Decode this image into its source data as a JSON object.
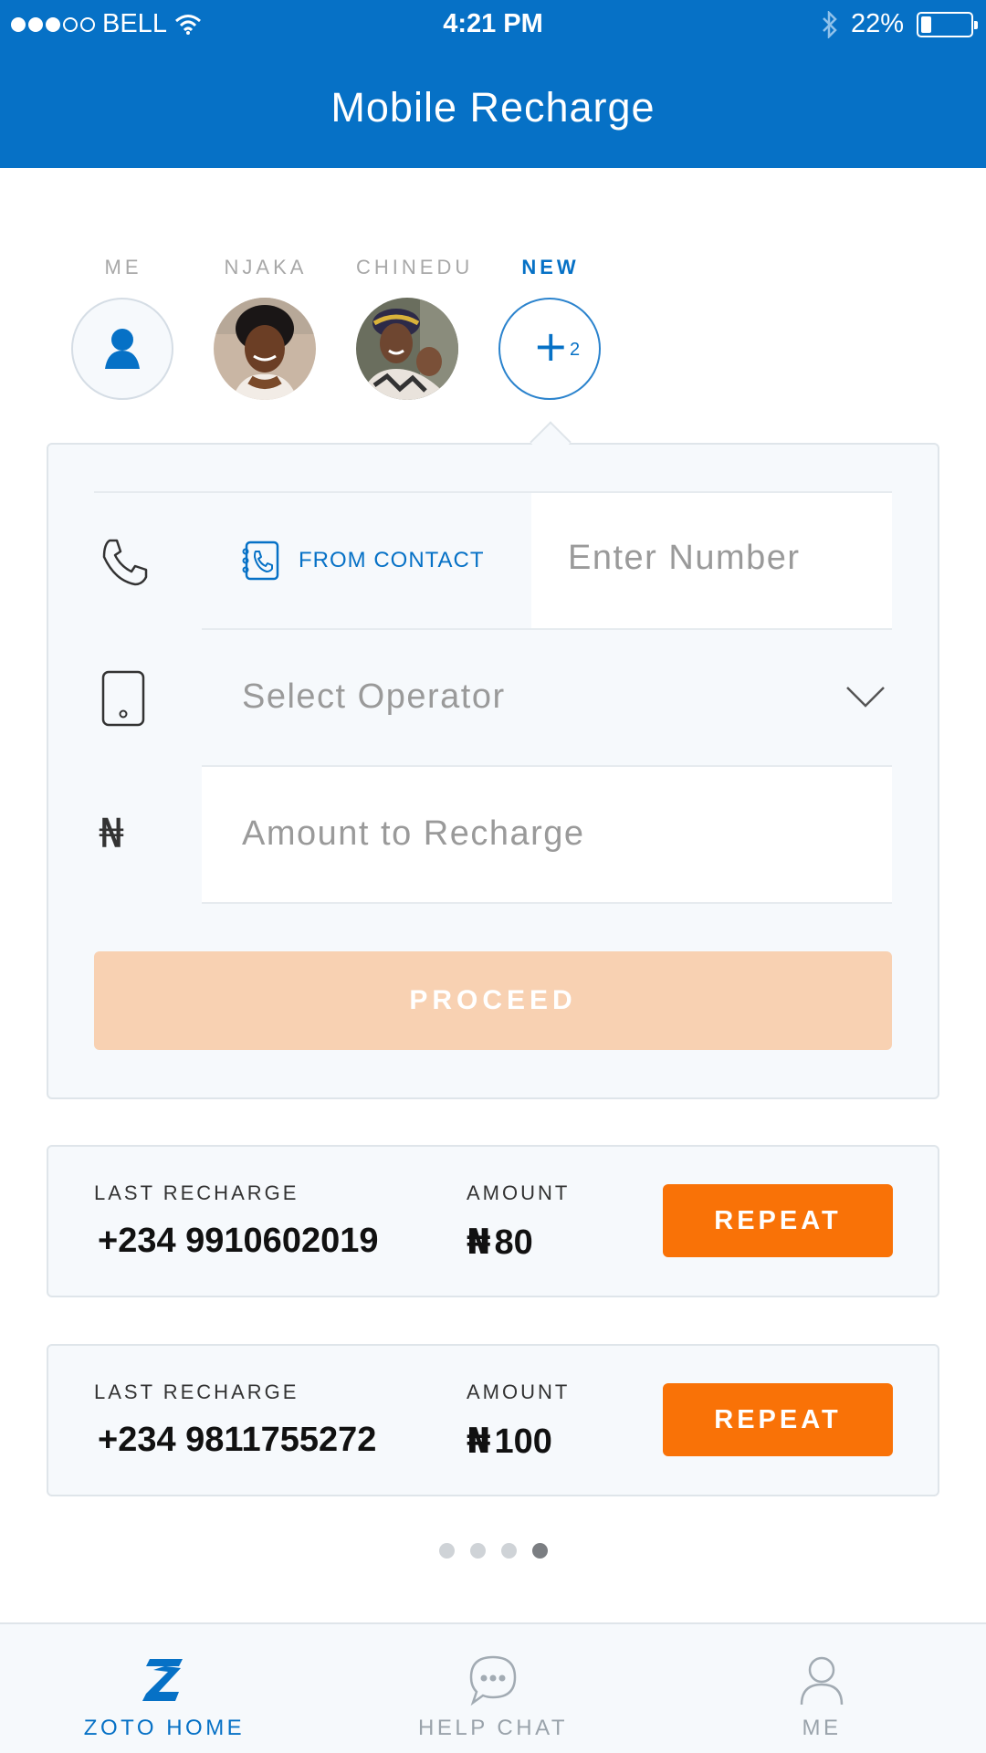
{
  "status_bar": {
    "carrier": "BELL",
    "time": "4:21 PM",
    "battery": "22%",
    "battery_level": 0.22
  },
  "header": {
    "title": "Mobile Recharge"
  },
  "recipients": [
    {
      "label": "ME",
      "icon": "user-icon"
    },
    {
      "label": "NJAKA",
      "icon": "contact-photo"
    },
    {
      "label": "CHINEDU",
      "icon": "contact-photo"
    },
    {
      "label": "NEW",
      "icon": "plus-icon",
      "count": "2"
    }
  ],
  "form": {
    "from_contact": "FROM CONTACT",
    "number_placeholder": "Enter Number",
    "operator_placeholder": "Select Operator",
    "amount_placeholder": "Amount to Recharge",
    "currency_symbol": "₦",
    "proceed": "PROCEED"
  },
  "last_recharges": [
    {
      "label": "LAST RECHARGE",
      "number": "+234 9910602019",
      "amount_label": "AMOUNT",
      "currency": "₦",
      "amount": "80",
      "action": "REPEAT"
    },
    {
      "label": "LAST RECHARGE",
      "number": "+234 9811755272",
      "amount_label": "AMOUNT",
      "currency": "₦",
      "amount": "100",
      "action": "REPEAT"
    }
  ],
  "pager": {
    "pages": 4,
    "active": 4
  },
  "tabs": [
    {
      "label": "ZOTO HOME",
      "icon": "zoto-logo-icon",
      "active": true
    },
    {
      "label": "HELP CHAT",
      "icon": "chat-bubble-icon",
      "active": false
    },
    {
      "label": "ME",
      "icon": "profile-icon",
      "active": false
    }
  ],
  "colors": {
    "primary": "#0671c6",
    "accent": "#f97207",
    "proceed_disabled": "#f8d1b2",
    "card_bg": "#f6f9fc"
  }
}
